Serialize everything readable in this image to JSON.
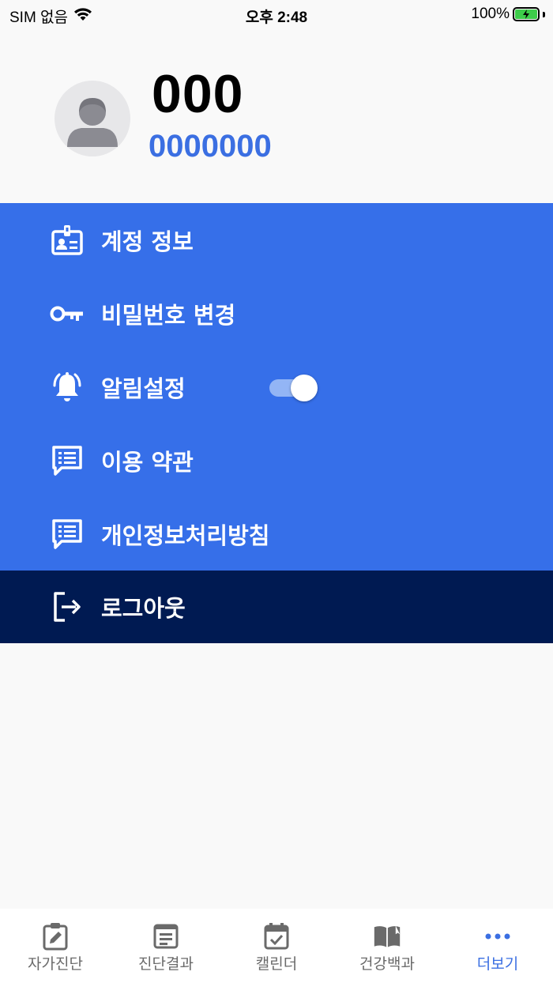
{
  "status_bar": {
    "carrier": "SIM 없음",
    "time": "오후 2:48",
    "battery": "100%"
  },
  "profile": {
    "name": "000",
    "id": "0000000"
  },
  "menu": {
    "items": [
      {
        "label": "계정 정보",
        "icon": "id-badge-icon"
      },
      {
        "label": "비밀번호 변경",
        "icon": "key-icon"
      },
      {
        "label": "알림설정",
        "icon": "bell-ringing-icon",
        "toggle_on": true
      },
      {
        "label": "이용 약관",
        "icon": "list-message-icon"
      },
      {
        "label": "개인정보처리방침",
        "icon": "list-message-icon"
      }
    ],
    "logout_label": "로그아웃"
  },
  "tabbar": {
    "tabs": [
      {
        "label": "자가진단",
        "icon": "clipboard-edit-icon",
        "active": false
      },
      {
        "label": "진단결과",
        "icon": "document-list-icon",
        "active": false
      },
      {
        "label": "캘린더",
        "icon": "calendar-check-icon",
        "active": false
      },
      {
        "label": "건강백과",
        "icon": "open-book-icon",
        "active": false
      },
      {
        "label": "더보기",
        "icon": "more-dots-icon",
        "active": true
      }
    ]
  },
  "colors": {
    "accent": "#3b6fe2",
    "menu_bg": "#366fe9",
    "logout_bg": "#001a52",
    "battery_fill": "#3dcc4a"
  }
}
